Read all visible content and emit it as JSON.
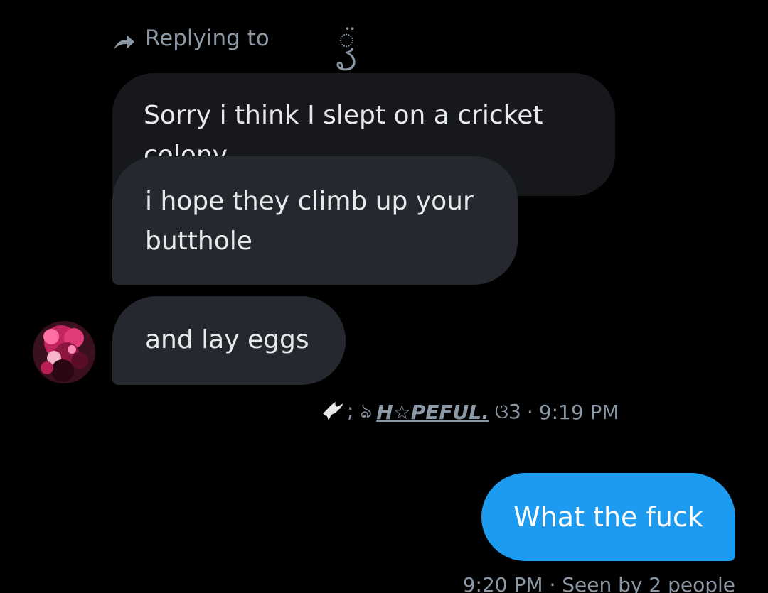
{
  "colors": {
    "background": "#000000",
    "bubble_received_dark": "#16181c",
    "bubble_received": "#25292f",
    "bubble_sent": "#1d9bf0",
    "text_primary": "#e7e9ea",
    "text_secondary": "#8b98a5"
  },
  "reply_context": {
    "icon": "reply-arrow-icon",
    "label": "Replying to",
    "quoted_glyph": "ꦽ̈"
  },
  "messages": {
    "received": [
      {
        "text": "Sorry i think I slept on a cricket colony"
      },
      {
        "text": "i hope they climb up your butthole"
      },
      {
        "text": "and lay eggs"
      }
    ],
    "received_meta": {
      "icon": "dove-icon",
      "sender_prefix": "; ঌ",
      "sender_name": "H☆PEFUL.",
      "sender_suffix": "ଓ3",
      "separator": "·",
      "time": "9:19 PM"
    },
    "sent": [
      {
        "text": "What the fuck"
      }
    ],
    "sent_meta": {
      "text": "9:20 PM · Seen by 2 people"
    }
  },
  "avatar": {
    "icon": "user-avatar"
  }
}
